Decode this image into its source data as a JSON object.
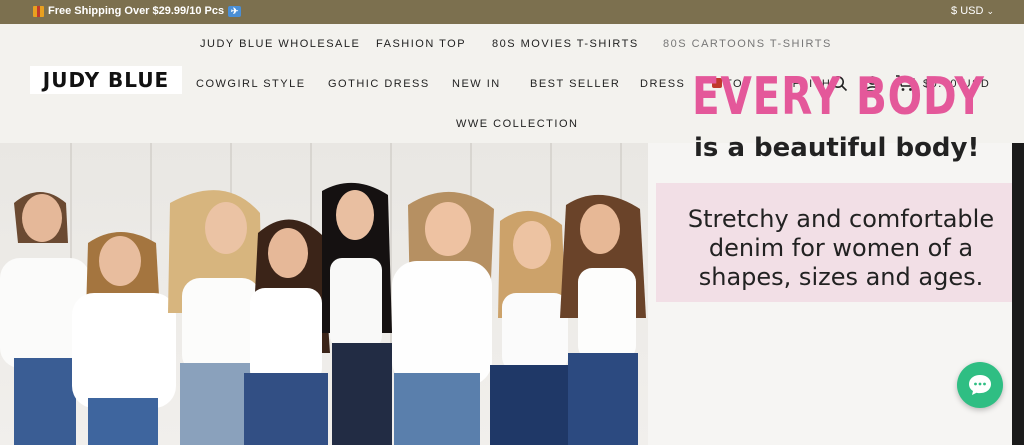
{
  "announcement": {
    "promo_text": "Free Shipping Over $29.99/10 Pcs",
    "currency": "$ USD",
    "icons": [
      "gift-icon",
      "airplane-icon",
      "chevron-down-icon"
    ]
  },
  "header": {
    "logo_text": "JUDY BLUE",
    "nav_row1": [
      "JUDY BLUE WHOLESALE",
      "FASHION TOP",
      "80S MOVIES T-SHIRTS",
      "80S CARTOONS T-SHIRTS"
    ],
    "nav_row2": [
      "COWGIRL STYLE",
      "GOTHIC DRESS",
      "NEW IN",
      "BEST SELLER",
      "DRESS",
      "TOP",
      "†FAITH"
    ],
    "nav_row3": [
      "WWE COLLECTION"
    ],
    "cart_total": "$0.00 USD",
    "icons": [
      "search-icon",
      "account-icon",
      "cart-icon"
    ]
  },
  "hero": {
    "headline": "EVERY BODY",
    "subheadline": "is a beautiful body!",
    "body_lines": [
      "Stretchy and comfortable",
      "denim for women of a",
      "shapes, sizes and ages."
    ],
    "colors": {
      "headline": "#e4589a",
      "panel_pink": "#f2dfe6",
      "topbar": "#7c704f",
      "chat": "#2fbe83"
    }
  },
  "chat": {
    "icon": "chat-bubble-icon"
  }
}
